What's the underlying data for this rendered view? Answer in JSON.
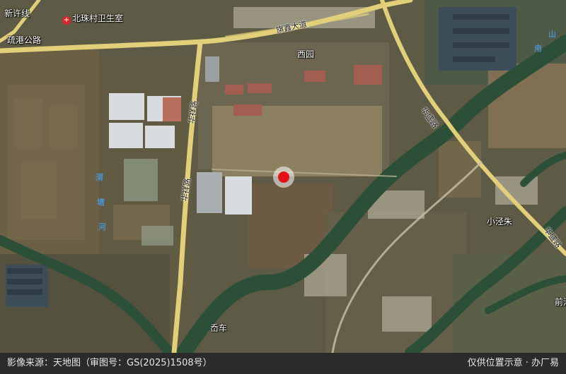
{
  "map": {
    "labels": {
      "xinxu": "新许线",
      "clinic": "北珠村卫生室",
      "shugang": "疏港公路",
      "qixin": "旗鑫大道",
      "xiyuan": "西园",
      "huaxiang_1": "华祥路",
      "huaxiang_2": "华祥路",
      "huasheng_1": "华盛路",
      "huasheng_2": "华盛路",
      "xiaojingzhu": "小泾朱",
      "pangui": "岙车",
      "qianhe": "前沟",
      "river_1": "渭",
      "river_2": "塘",
      "river_3": "河",
      "river_east_1": "甪",
      "river_east_2": "山"
    },
    "clinic_icon": "hospital-cross-icon",
    "marker_icon": "location-pin-icon",
    "colors": {
      "marker": "#e3101a",
      "road": "#e2cf7a",
      "water": "#2c4f38"
    }
  },
  "footer": {
    "source": "影像来源：天地图（审图号：GS(2025)1508号）",
    "notice": "仅供位置示意 · 办厂易"
  }
}
